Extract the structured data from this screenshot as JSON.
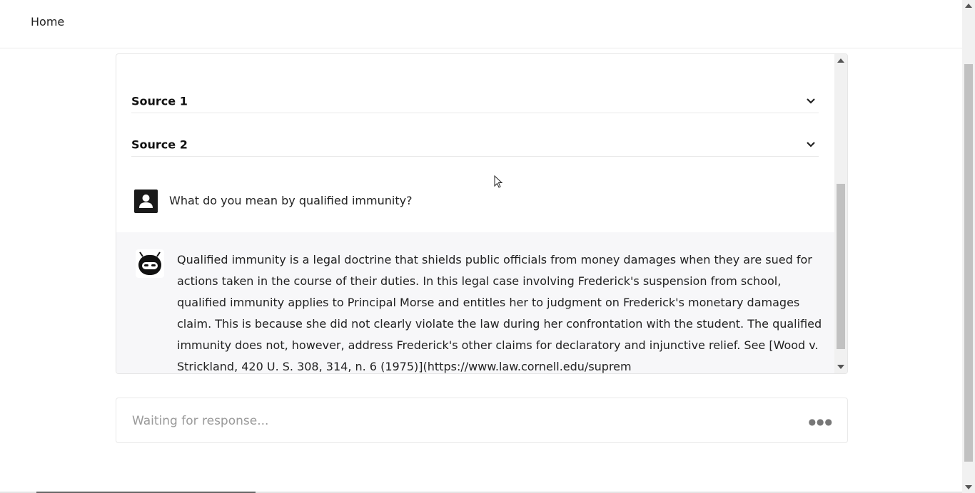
{
  "nav": {
    "home_label": "Home"
  },
  "sources": [
    {
      "label": "Source 1"
    },
    {
      "label": "Source 2"
    }
  ],
  "messages": {
    "user": {
      "text": "What do you mean by qualified immunity?"
    },
    "bot": {
      "text": "Qualified immunity is a legal doctrine that shields public officials from money damages when they are sued for actions taken in the course of their duties. In this legal case involving Frederick's suspension from school, qualified immunity applies to Principal Morse and entitles her to judgment on Frederick's monetary damages claim. This is because she did not clearly violate the law during her confrontation with the student. The qualified immunity does not, however, address Frederick's other claims for declaratory and injunctive relief. See [Wood v. Strickland, 420 U. S. 308, 314, n. 6 (1975)](https://www.law.cornell.edu/suprem"
    }
  },
  "input": {
    "placeholder": "Waiting for response...",
    "value": ""
  },
  "icons": {
    "chevron": "chevron-down-icon",
    "user": "user-avatar-icon",
    "bot": "robot-avatar-icon",
    "more": "more-dots-icon"
  },
  "colors": {
    "avatar_dark": "#1a1a1a",
    "bot_bg": "#f7f7f9"
  }
}
